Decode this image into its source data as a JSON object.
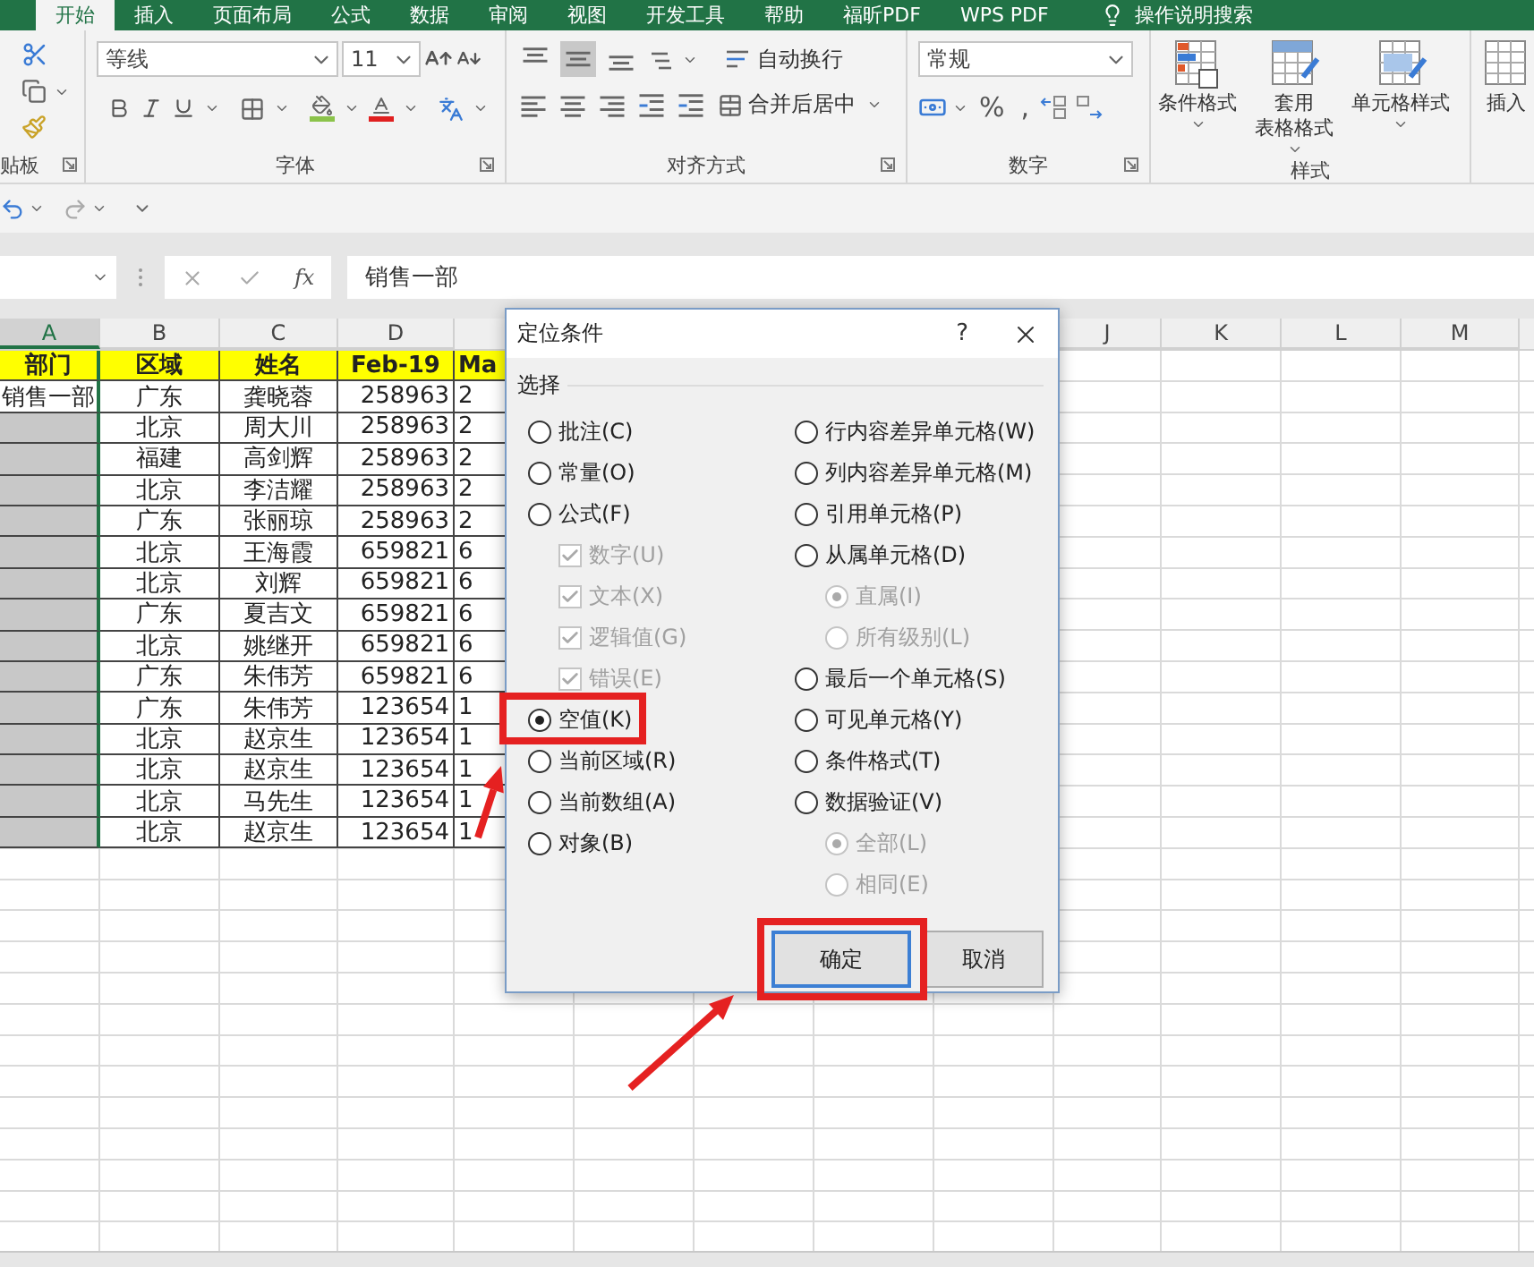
{
  "ribbon_tabs": [
    {
      "label": "开始",
      "selected": true
    },
    {
      "label": "插入",
      "selected": false
    },
    {
      "label": "页面布局",
      "selected": false
    },
    {
      "label": "公式",
      "selected": false
    },
    {
      "label": "数据",
      "selected": false
    },
    {
      "label": "审阅",
      "selected": false
    },
    {
      "label": "视图",
      "selected": false
    },
    {
      "label": "开发工具",
      "selected": false
    },
    {
      "label": "帮助",
      "selected": false
    },
    {
      "label": "福昕PDF",
      "selected": false
    },
    {
      "label": "WPS PDF",
      "selected": false
    }
  ],
  "search_hint": "操作说明搜索",
  "ribbon": {
    "clipboard": {
      "label": "贴板"
    },
    "font": {
      "label": "字体",
      "font_name": "等线",
      "font_size": "11"
    },
    "alignment": {
      "label": "对齐方式",
      "vertical_align": [
        {
          "selected": false
        },
        {
          "selected": true
        },
        {
          "selected": false
        }
      ],
      "wrap_text": "自动换行",
      "merge_center": "合并后居中"
    },
    "number": {
      "label": "数字",
      "format": "常规",
      "percent": "%",
      "comma": ","
    },
    "styles": {
      "label": "样式",
      "buttons": [
        {
          "lines": [
            "条件格式"
          ]
        },
        {
          "lines": [
            "套用",
            "表格格式"
          ]
        },
        {
          "lines": [
            "单元格样式"
          ]
        }
      ]
    },
    "insert": {
      "label": "插入"
    }
  },
  "formula_bar": {
    "fx": "fx",
    "value": "销售一部"
  },
  "sheet": {
    "left_columns": [
      {
        "label": "A",
        "selected": true
      },
      {
        "label": "B",
        "selected": false
      },
      {
        "label": "C",
        "selected": false
      },
      {
        "label": "D",
        "selected": false
      }
    ],
    "right_columns": [
      {
        "label": "J",
        "selected": false
      },
      {
        "label": "K",
        "selected": false
      },
      {
        "label": "L",
        "selected": false
      },
      {
        "label": "M",
        "selected": false
      }
    ],
    "header_row": [
      "部门",
      "区域",
      "姓名",
      "Feb-19",
      "Ma"
    ],
    "rows": [
      {
        "dept": "销售一部",
        "region": "广东",
        "name": "龚晓蓉",
        "feb": "258963",
        "mar": "2",
        "selected": false
      },
      {
        "region": "北京",
        "name": "周大川",
        "feb": "258963",
        "mar": "2",
        "selected": true
      },
      {
        "region": "福建",
        "name": "高剑辉",
        "feb": "258963",
        "mar": "2",
        "selected": true
      },
      {
        "region": "北京",
        "name": "李洁耀",
        "feb": "258963",
        "mar": "2",
        "selected": true
      },
      {
        "region": "广东",
        "name": "张丽琼",
        "feb": "258963",
        "mar": "2",
        "selected": true
      },
      {
        "region": "北京",
        "name": "王海霞",
        "feb": "659821",
        "mar": "6",
        "selected": true
      },
      {
        "region": "北京",
        "name": "刘辉",
        "feb": "659821",
        "mar": "6",
        "selected": true
      },
      {
        "region": "广东",
        "name": "夏吉文",
        "feb": "659821",
        "mar": "6",
        "selected": true
      },
      {
        "region": "北京",
        "name": "姚继开",
        "feb": "659821",
        "mar": "6",
        "selected": true
      },
      {
        "region": "广东",
        "name": "朱伟芳",
        "feb": "659821",
        "mar": "6",
        "selected": true
      },
      {
        "region": "广东",
        "name": "朱伟芳",
        "feb": "123654",
        "mar": "1",
        "selected": true
      },
      {
        "region": "北京",
        "name": "赵京生",
        "feb": "123654",
        "mar": "1",
        "selected": true
      },
      {
        "region": "北京",
        "name": "赵京生",
        "feb": "123654",
        "mar": "1",
        "selected": true
      },
      {
        "region": "北京",
        "name": "马先生",
        "feb": "123654",
        "mar": "1",
        "selected": true
      },
      {
        "region": "北京",
        "name": "赵京生",
        "feb": "123654",
        "mar": "1",
        "selected": true
      }
    ]
  },
  "dialog": {
    "title": "定位条件",
    "help": "?",
    "section": "选择",
    "left_options": [
      {
        "kind": "radio",
        "label": "批注(C)",
        "selected": false,
        "disabled": false
      },
      {
        "kind": "radio",
        "label": "常量(O)",
        "selected": false,
        "disabled": false
      },
      {
        "kind": "radio",
        "label": "公式(F)",
        "selected": false,
        "disabled": false,
        "children": [
          {
            "kind": "checkbox",
            "label": "数字(U)",
            "checked": true,
            "disabled": true
          },
          {
            "kind": "checkbox",
            "label": "文本(X)",
            "checked": true,
            "disabled": true
          },
          {
            "kind": "checkbox",
            "label": "逻辑值(G)",
            "checked": true,
            "disabled": true
          },
          {
            "kind": "checkbox",
            "label": "错误(E)",
            "checked": true,
            "disabled": true
          }
        ]
      },
      {
        "kind": "radio",
        "label": "空值(K)",
        "selected": true,
        "disabled": false
      },
      {
        "kind": "radio",
        "label": "当前区域(R)",
        "selected": false,
        "disabled": false
      },
      {
        "kind": "radio",
        "label": "当前数组(A)",
        "selected": false,
        "disabled": false
      },
      {
        "kind": "radio",
        "label": "对象(B)",
        "selected": false,
        "disabled": false
      }
    ],
    "right_options": [
      {
        "kind": "radio",
        "label": "行内容差异单元格(W)",
        "selected": false,
        "disabled": false
      },
      {
        "kind": "radio",
        "label": "列内容差异单元格(M)",
        "selected": false,
        "disabled": false
      },
      {
        "kind": "radio",
        "label": "引用单元格(P)",
        "selected": false,
        "disabled": false
      },
      {
        "kind": "radio",
        "label": "从属单元格(D)",
        "selected": false,
        "disabled": false,
        "children": [
          {
            "kind": "radio",
            "label": "直属(I)",
            "selected": true,
            "disabled": true
          },
          {
            "kind": "radio",
            "label": "所有级别(L)",
            "selected": false,
            "disabled": true
          }
        ]
      },
      {
        "kind": "radio",
        "label": "最后一个单元格(S)",
        "selected": false,
        "disabled": false
      },
      {
        "kind": "radio",
        "label": "可见单元格(Y)",
        "selected": false,
        "disabled": false
      },
      {
        "kind": "radio",
        "label": "条件格式(T)",
        "selected": false,
        "disabled": false
      },
      {
        "kind": "radio",
        "label": "数据验证(V)",
        "selected": false,
        "disabled": false,
        "children": [
          {
            "kind": "radio",
            "label": "全部(L)",
            "selected": true,
            "disabled": true
          },
          {
            "kind": "radio",
            "label": "相同(E)",
            "selected": false,
            "disabled": true
          }
        ]
      }
    ],
    "buttons": [
      {
        "label": "确定",
        "default": true
      },
      {
        "label": "取消",
        "default": false
      }
    ]
  }
}
